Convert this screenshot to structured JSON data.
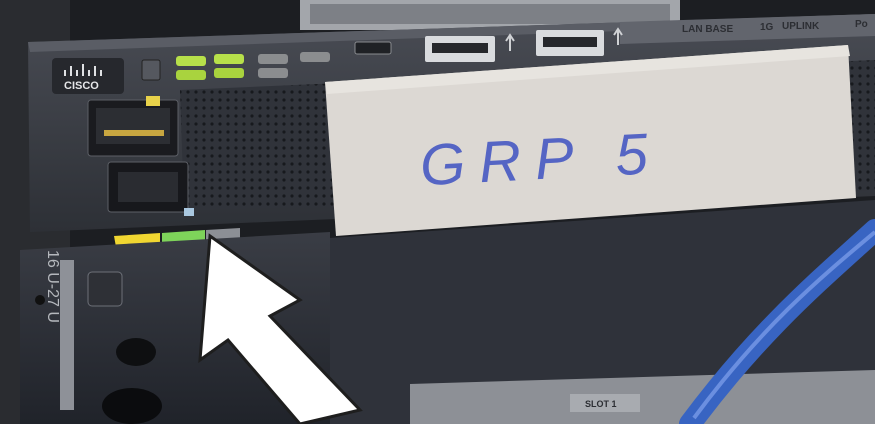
{
  "chassis": {
    "brand": "CISCO",
    "top_strip_labels": [
      "LAN BASE",
      "1G",
      "UPLINK",
      "Po"
    ]
  },
  "label_card": {
    "text": "GRP 5"
  },
  "status_leds": [
    {
      "name": "led-syst",
      "color": "#b7e04a"
    },
    {
      "name": "led-stat",
      "color": "#b7e04a"
    },
    {
      "name": "led-xpss",
      "color": "#a9d33e"
    },
    {
      "name": "led-dplx",
      "color": "#a9d33e"
    },
    {
      "name": "led-spd",
      "color": "#8b8d8f"
    },
    {
      "name": "led-mode",
      "color": "#8b8d8f"
    },
    {
      "name": "led-poe",
      "color": "#8b8d8f"
    }
  ],
  "panel_tags": {
    "slot": "SLOT 1",
    "rack_unit": "16 U-27 U"
  },
  "colors": {
    "panel": "#3b3e45",
    "card": "#dcd8d3",
    "ink": "#5565c4",
    "arrow": "#ffffff",
    "cable": "#3864c2",
    "indicator_yellow": "#f0d631",
    "indicator_green": "#7ed45a"
  }
}
